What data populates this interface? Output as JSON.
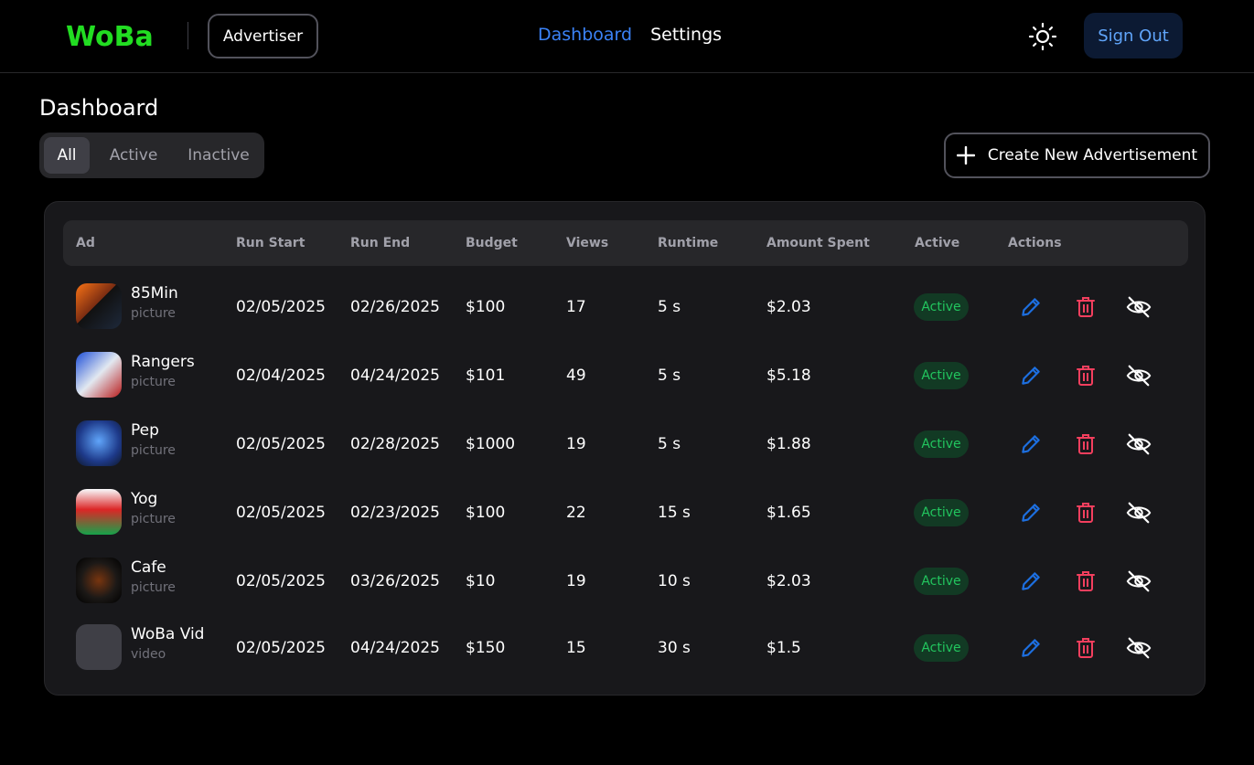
{
  "header": {
    "logo_text": "WoBa",
    "role_label": "Advertiser",
    "nav": [
      {
        "label": "Dashboard",
        "active": true
      },
      {
        "label": "Settings",
        "active": false
      }
    ],
    "theme_icon": "sun-icon",
    "signout_label": "Sign Out"
  },
  "page": {
    "title": "Dashboard",
    "filters": [
      "All",
      "Active",
      "Inactive"
    ],
    "selected_filter": "All",
    "create_label": "Create New Advertisement"
  },
  "table": {
    "columns": [
      "Ad",
      "Run Start",
      "Run End",
      "Budget",
      "Views",
      "Runtime",
      "Amount Spent",
      "Active",
      "Actions"
    ],
    "rows": [
      {
        "name": "85Min",
        "type": "picture",
        "run_start": "02/05/2025",
        "run_end": "02/26/2025",
        "budget": "$100",
        "views": "17",
        "runtime": "5 s",
        "spent": "$2.03",
        "status": "Active"
      },
      {
        "name": "Rangers",
        "type": "picture",
        "run_start": "02/04/2025",
        "run_end": "04/24/2025",
        "budget": "$101",
        "views": "49",
        "runtime": "5 s",
        "spent": "$5.18",
        "status": "Active"
      },
      {
        "name": "Pep",
        "type": "picture",
        "run_start": "02/05/2025",
        "run_end": "02/28/2025",
        "budget": "$1000",
        "views": "19",
        "runtime": "5 s",
        "spent": "$1.88",
        "status": "Active"
      },
      {
        "name": "Yog",
        "type": "picture",
        "run_start": "02/05/2025",
        "run_end": "02/23/2025",
        "budget": "$100",
        "views": "22",
        "runtime": "15 s",
        "spent": "$1.65",
        "status": "Active"
      },
      {
        "name": "Cafe",
        "type": "picture",
        "run_start": "02/05/2025",
        "run_end": "03/26/2025",
        "budget": "$10",
        "views": "19",
        "runtime": "10 s",
        "spent": "$2.03",
        "status": "Active"
      },
      {
        "name": "WoBa Vid",
        "type": "video",
        "run_start": "02/05/2025",
        "run_end": "04/24/2025",
        "budget": "$150",
        "views": "15",
        "runtime": "30 s",
        "spent": "$1.5",
        "status": "Active"
      }
    ]
  },
  "colors": {
    "brand_green": "#22dd22",
    "accent_blue": "#3b82f6",
    "danger_pink": "#f43f5e",
    "active_green": "#22c55e"
  },
  "icons": [
    "sun-icon",
    "plus-icon",
    "pencil-icon",
    "trash-icon",
    "eye-off-icon"
  ]
}
